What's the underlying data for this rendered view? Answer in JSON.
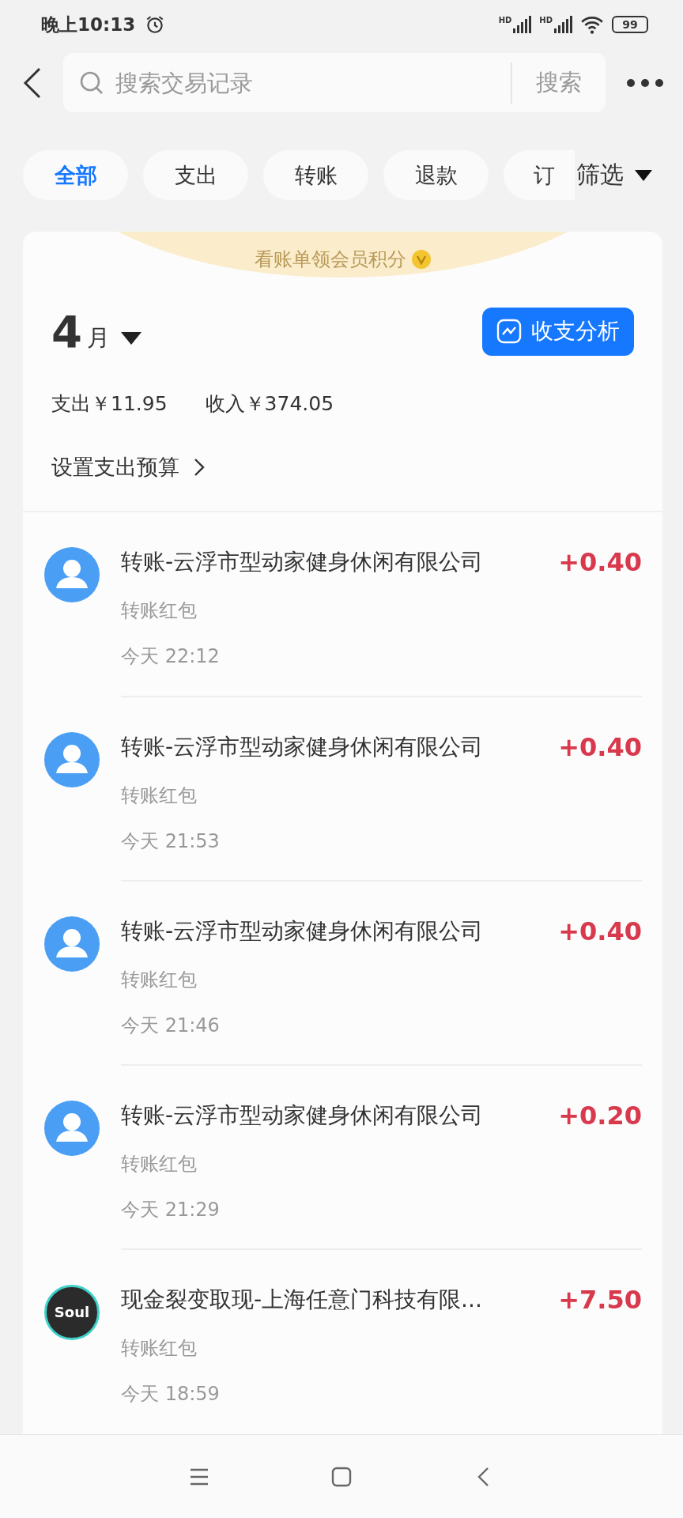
{
  "status_bar": {
    "time": "晚上10:13",
    "signals": [
      "HD",
      "HD"
    ],
    "battery": "99"
  },
  "search": {
    "placeholder": "搜索交易记录",
    "button": "搜索"
  },
  "tabs": [
    {
      "label": "全部",
      "selected": true
    },
    {
      "label": "支出",
      "selected": false
    },
    {
      "label": "转账",
      "selected": false
    },
    {
      "label": "退款",
      "selected": false
    },
    {
      "label": "订",
      "selected": false
    }
  ],
  "filter": "筛选",
  "banner": "看账单领会员积分",
  "month": {
    "number": "4",
    "unit": "月"
  },
  "analysis_button": "收支分析",
  "summary": [
    "支出￥11.95",
    "收入￥374.05"
  ],
  "budget_link": "设置支出预算",
  "transactions": [
    {
      "kind": "person",
      "title": "转账-云浮市型动家健身休闲有限公司",
      "amount": "+0.40",
      "category": "转账红包",
      "time": "今天 22:12"
    },
    {
      "kind": "person",
      "title": "转账-云浮市型动家健身休闲有限公司",
      "amount": "+0.40",
      "category": "转账红包",
      "time": "今天 21:53"
    },
    {
      "kind": "person",
      "title": "转账-云浮市型动家健身休闲有限公司",
      "amount": "+0.40",
      "category": "转账红包",
      "time": "今天 21:46"
    },
    {
      "kind": "person",
      "title": "转账-云浮市型动家健身休闲有限公司",
      "amount": "+0.20",
      "category": "转账红包",
      "time": "今天 21:29"
    },
    {
      "kind": "logo",
      "logo_text": "Soul",
      "title": "现金裂变取现-上海任意门科技有限...",
      "amount": "+7.50",
      "category": "转账红包",
      "time": "今天 18:59"
    }
  ]
}
